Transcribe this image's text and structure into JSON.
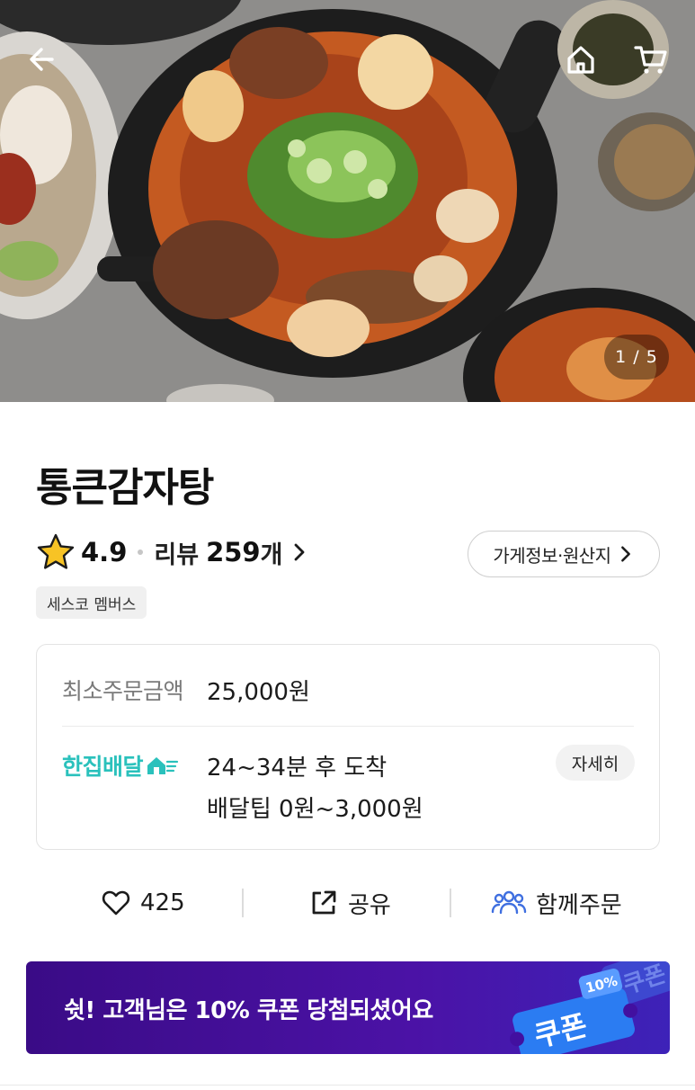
{
  "hero": {
    "counter": "1 / 5"
  },
  "store": {
    "name": "통큰감자탕",
    "rating": "4.9",
    "review_label": "리뷰",
    "review_count": "259",
    "review_unit": "개",
    "info_button": "가게정보·원산지",
    "member_badge": "세스코 멤버스"
  },
  "delivery": {
    "min_order_label": "최소주문금액",
    "min_order_value": "25,000원",
    "service_name": "한집배달",
    "eta": "24~34분 후 도착",
    "tip": "배달팁 0원~3,000원",
    "detail_button": "자세히",
    "brand_color": "#2ac1bc"
  },
  "actions": {
    "like_count": "425",
    "share_label": "공유",
    "group_order_label": "함께주문",
    "group_icon_color": "#3f6fe0"
  },
  "banner": {
    "text": "쉿! 고객님은 10% 쿠폰 당첨되셨어요",
    "coupon_word": "쿠폰",
    "coupon_percent": "10%",
    "bg_color": "#3a0b86"
  },
  "icons": {
    "back": "arrow-left-icon",
    "home": "home-icon",
    "cart": "cart-icon",
    "star": "star-icon",
    "heart": "heart-icon",
    "share": "share-icon",
    "group": "group-icon"
  }
}
